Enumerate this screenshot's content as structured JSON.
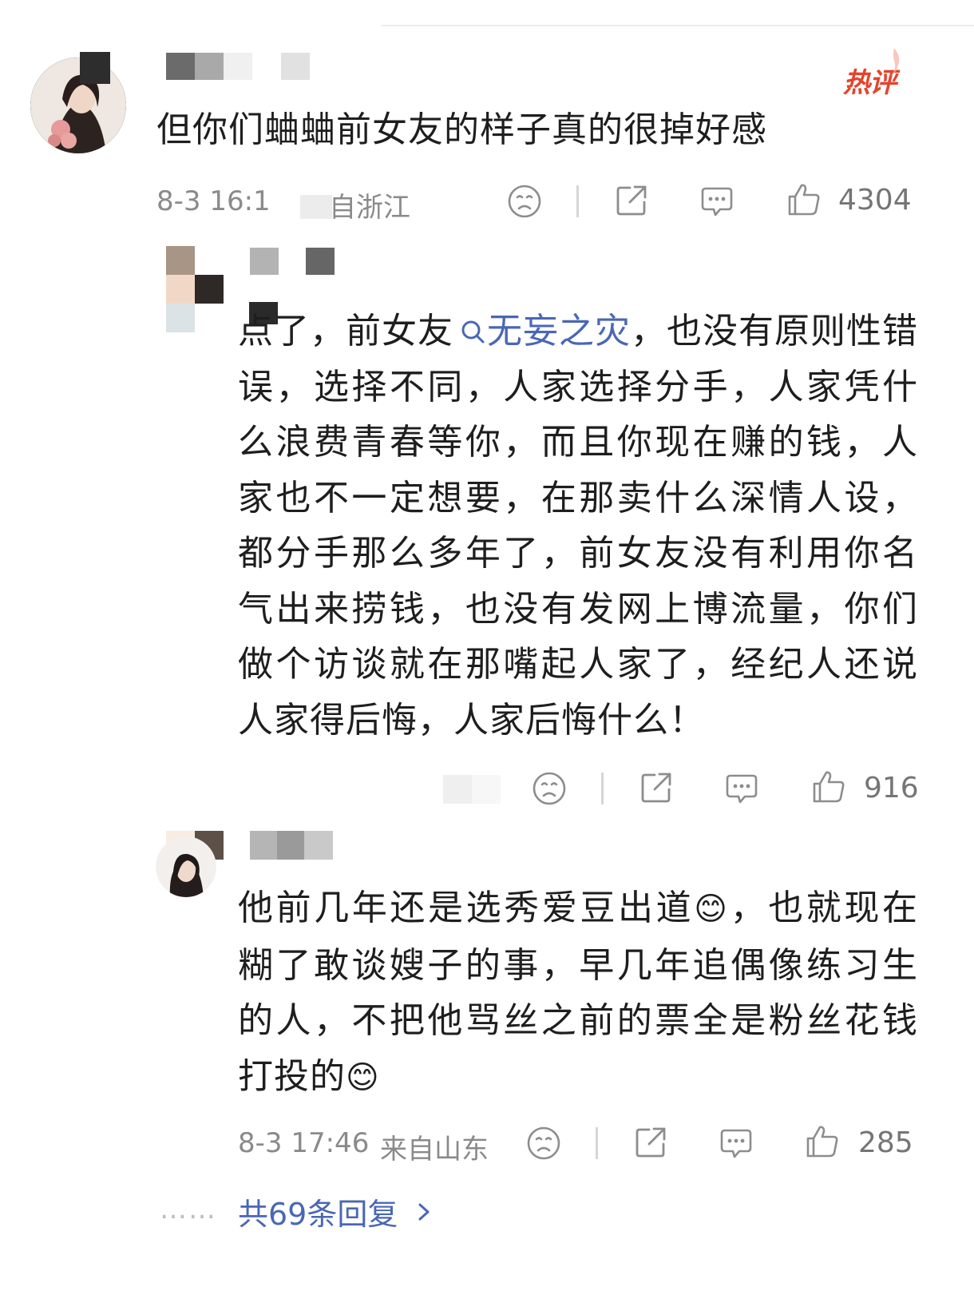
{
  "hot_badge": "热评",
  "comment1": {
    "text": "但你们蛐蛐前女友的样子真的很掉好感",
    "time": "8-3 16:1",
    "location": "自浙江",
    "likes": "4304"
  },
  "reply1": {
    "text_before": "点了，前女友",
    "topic": "无妄之灾",
    "text_after": "，也没有原则性错误，选择不同，人家选择分手，人家凭什么浪费青春等你，而且你现在赚的钱，人家也不一定想要，在那卖什么深情人设，都分手那么多年了，前女友没有利用你名气出来捞钱，也没有发网上博流量，你们做个访谈就在那嘴起人家了，经纪人还说人家得后悔，人家后悔什么！",
    "likes": "916"
  },
  "reply2": {
    "text_part1": "他前几年还是选秀爱豆出道",
    "emoji1": "😊",
    "text_part2": "，也就现在糊了敢谈嫂子的事，早几年追偶像练习生的人，不把他骂丝之前的票全是粉丝花钱打投的",
    "emoji2": "😊",
    "time": "8-3 17:46",
    "location": "来自山东",
    "likes": "285"
  },
  "more_replies": {
    "label": "共69条回复",
    "dots": "……"
  },
  "icons": [
    "sad-face-icon",
    "share-icon",
    "comment-icon",
    "thumbs-up-icon",
    "search-icon",
    "chevron-right-icon"
  ],
  "colors": {
    "link": "#4a67b6",
    "hot": "#e2452e",
    "meta": "#8a8a8a",
    "text": "#1e1e1e"
  }
}
